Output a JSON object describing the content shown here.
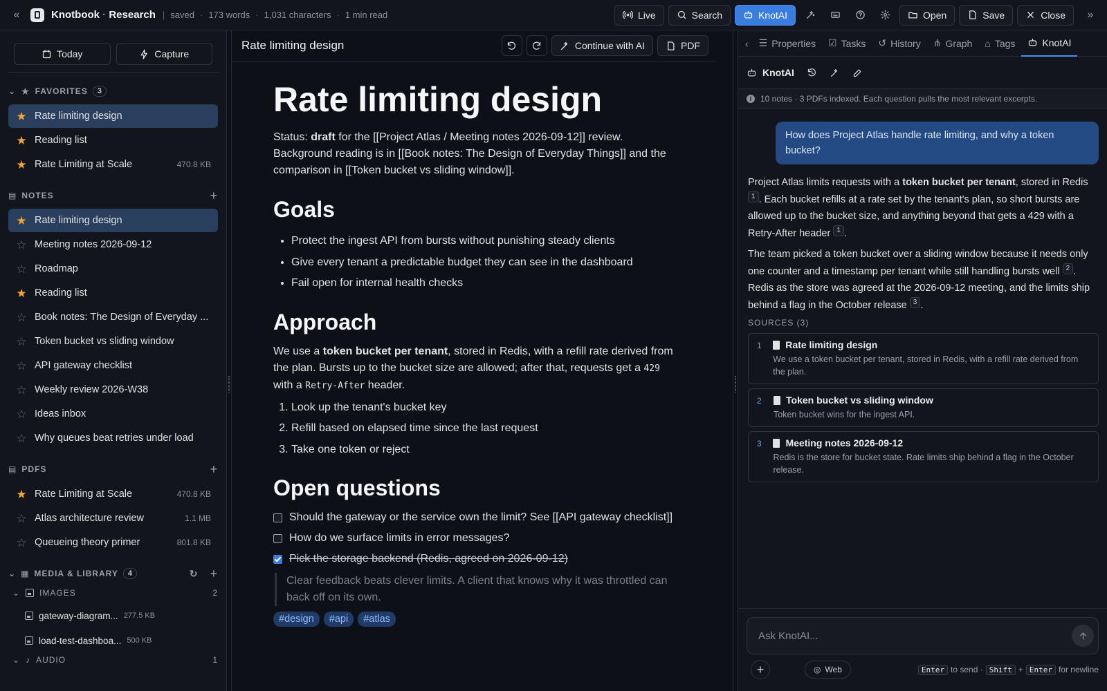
{
  "topbar": {
    "app_name": "Knotbook",
    "separator": "·",
    "workspace": "Research",
    "status": "saved",
    "words": "173 words",
    "characters": "1,031 characters",
    "read_time": "1 min read",
    "buttons": {
      "live": "Live",
      "search": "Search",
      "knotai": "KnotAI",
      "open": "Open",
      "save": "Save",
      "close": "Close"
    },
    "accent": "#3a7de0"
  },
  "sidebar": {
    "today": "Today",
    "capture": "Capture",
    "favorites": {
      "title": "FAVORITES",
      "count": "3",
      "items": [
        {
          "name": "Rate limiting design",
          "size": "",
          "starred": true,
          "active": true
        },
        {
          "name": "Reading list",
          "size": "",
          "starred": true,
          "active": false
        },
        {
          "name": "Rate Limiting at Scale",
          "size": "470.8 KB",
          "starred": true,
          "active": false
        }
      ]
    },
    "notes": {
      "title": "NOTES",
      "items": [
        {
          "name": "Rate limiting design",
          "starred": true,
          "active": true
        },
        {
          "name": "Meeting notes 2026-09-12",
          "starred": false,
          "active": false
        },
        {
          "name": "Roadmap",
          "starred": false,
          "active": false
        },
        {
          "name": "Reading list",
          "starred": true,
          "active": false
        },
        {
          "name": "Book notes: The Design of Everyday ...",
          "starred": false,
          "active": false
        },
        {
          "name": "Token bucket vs sliding window",
          "starred": false,
          "active": false
        },
        {
          "name": "API gateway checklist",
          "starred": false,
          "active": false
        },
        {
          "name": "Weekly review 2026-W38",
          "starred": false,
          "active": false
        },
        {
          "name": "Ideas inbox",
          "starred": false,
          "active": false
        },
        {
          "name": "Why queues beat retries under load",
          "starred": false,
          "active": false
        }
      ]
    },
    "pdfs": {
      "title": "PDFS",
      "items": [
        {
          "name": "Rate Limiting at Scale",
          "size": "470.8 KB",
          "starred": true
        },
        {
          "name": "Atlas architecture review",
          "size": "1.1 MB",
          "starred": false
        },
        {
          "name": "Queueing theory primer",
          "size": "801.8 KB",
          "starred": false
        }
      ]
    },
    "media": {
      "title": "MEDIA & LIBRARY",
      "count": "4",
      "images": {
        "title": "IMAGES",
        "count": "2",
        "items": [
          {
            "name": "gateway-diagram...",
            "size": "277.5 KB"
          },
          {
            "name": "load-test-dashboa...",
            "size": "500 KB"
          }
        ]
      },
      "audio": {
        "title": "AUDIO",
        "count": "1"
      }
    }
  },
  "editor": {
    "tab_title": "Rate limiting design",
    "continue_ai": "Continue with AI",
    "pdf": "PDF",
    "title": "Rate limiting design",
    "intro": {
      "status_label": "Status: ",
      "status_value": "draft",
      "line1": " for the [[Project Atlas / Meeting notes 2026-09-12]] review.",
      "line2": "Background reading is in [[Book notes: The Design of Everyday Things]] and the comparison in [[Token bucket vs sliding window]]."
    },
    "goals_heading": "Goals",
    "goals": [
      "Protect the ingest API from bursts without punishing steady clients",
      "Give every tenant a predictable budget they can see in the dashboard",
      "Fail open for internal health checks"
    ],
    "approach_heading": "Approach",
    "approach": {
      "p1": "We use a ",
      "bold": "token bucket per tenant",
      "p2": ", stored in Redis, with a refill rate derived from the plan. Bursts up to the bucket size are allowed; after that, requests get a ",
      "code1": "429",
      "p3": " with a ",
      "code2": "Retry-After",
      "p4": " header."
    },
    "steps": [
      "Look up the tenant's bucket key",
      "Refill based on elapsed time since the last request",
      "Take one token or reject"
    ],
    "questions_heading": "Open questions",
    "tasks": [
      {
        "text": "Should the gateway or the service own the limit? See [[API gateway checklist]]",
        "done": false
      },
      {
        "text": "How do we surface limits in error messages?",
        "done": false
      },
      {
        "text": "Pick the storage backend (Redis, agreed on 2026-09-12)",
        "done": true
      }
    ],
    "quote": "Clear feedback beats clever limits. A client that knows why it was throttled can back off on its own.",
    "tags": [
      "#design",
      "#api",
      "#atlas"
    ]
  },
  "rpanel": {
    "tabs": [
      "Properties",
      "Tasks",
      "History",
      "Graph",
      "Tags",
      "KnotAI"
    ],
    "active_tab": "KnotAI",
    "sub_label": "KnotAI",
    "info": "10 notes · 3 PDFs indexed. Each question pulls the most relevant excerpts.",
    "question": "How does Project Atlas handle rate limiting, and why a token bucket?",
    "answer1": {
      "a": "Project Atlas limits requests with a ",
      "b": "token bucket per tenant",
      "c": ", stored in Redis ",
      "d": ". Each bucket refills at a rate set by the tenant's plan, so short bursts are allowed up to the bucket size, and anything beyond that gets a 429 with a Retry-After header ",
      "e": "."
    },
    "answer2": {
      "a": "The team picked a token bucket over a sliding window because it needs only one counter and a timestamp per tenant while still handling bursts well ",
      "b": ". Redis as the store was agreed at the 2026-09-12 meeting, and the limits ship behind a flag in the October release ",
      "c": "."
    },
    "cites": [
      "1",
      "1",
      "2",
      "3"
    ],
    "sources_head": "SOURCES (3)",
    "sources": [
      {
        "num": "1",
        "title": "Rate limiting design",
        "desc": "We use a token bucket per tenant, stored in Redis, with a refill rate derived from the plan."
      },
      {
        "num": "2",
        "title": "Token bucket vs sliding window",
        "desc": "Token bucket wins for the ingest API."
      },
      {
        "num": "3",
        "title": "Meeting notes 2026-09-12",
        "desc": "Redis is the store for bucket state. Rate limits ship behind a flag in the October release."
      }
    ],
    "ask_placeholder": "Ask KnotAI...",
    "web": "Web",
    "hint": {
      "k1": "Enter",
      "t1": "to send ·",
      "k2": "Shift",
      "plus": "+",
      "k3": "Enter",
      "t2": "for newline"
    }
  }
}
